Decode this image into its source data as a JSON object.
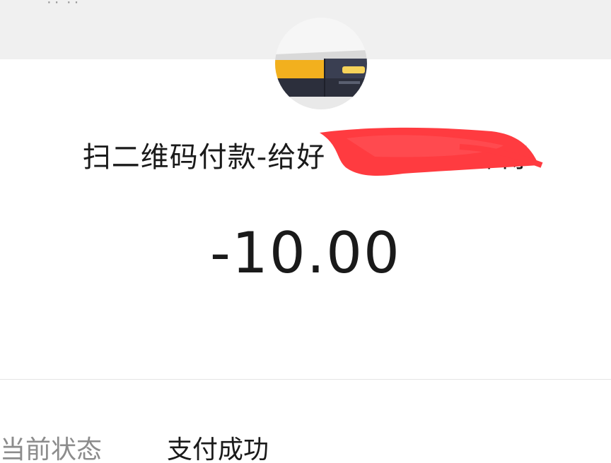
{
  "header": {
    "status_bar_fragment": "٠٠ ٠٠"
  },
  "payment": {
    "avatar": "merchant-photo",
    "title": "扫二维码付款-给好　　　　　师傅",
    "amount": "-10.00"
  },
  "details": {
    "status_label": "当前状态",
    "status_value": "支付成功"
  },
  "colors": {
    "background": "#ffffff",
    "top_band": "#f0f0f0",
    "text_primary": "#1a1a1a",
    "text_secondary": "#8c8c8c",
    "redaction": "#ff3b40"
  }
}
